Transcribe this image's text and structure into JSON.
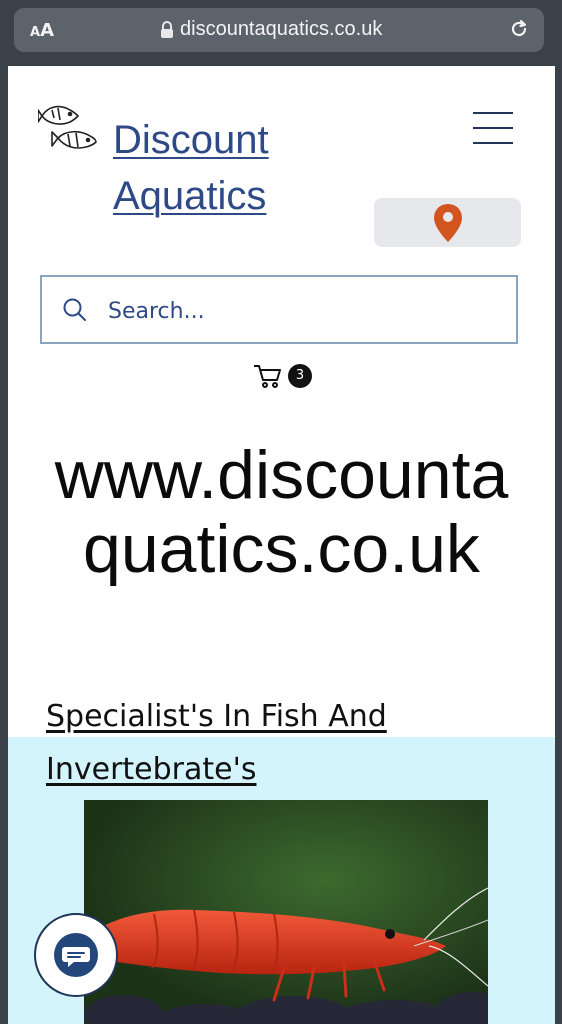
{
  "browser": {
    "text_size_label": "AA",
    "url": "discountaquatics.co.uk"
  },
  "header": {
    "brand_line1": "Discount",
    "brand_line2": "Aquatics"
  },
  "search": {
    "placeholder": "Search..."
  },
  "cart": {
    "count": "3"
  },
  "hero": {
    "line1": "www.discounta",
    "line2": "quatics.co.uk"
  },
  "section": {
    "heading_line1": "Specialist's In Fish And",
    "heading_line2": "Invertebrate's"
  },
  "colors": {
    "brand_blue": "#2d4a86",
    "location_pin": "#d2541f",
    "band_background": "#d4f4fb",
    "shrimp_red": "#e63b1d"
  },
  "icons": [
    "lock-icon",
    "reload-icon",
    "fish-logo-icon",
    "menu-icon",
    "location-pin-icon",
    "search-icon",
    "cart-icon",
    "chat-icon"
  ]
}
